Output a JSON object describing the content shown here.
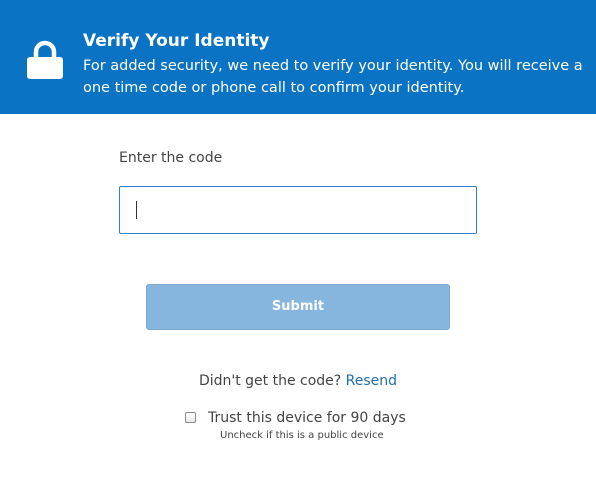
{
  "header": {
    "icon": "lock-icon",
    "title": "Verify Your Identity",
    "description": "For added security, we need to verify your identity. You will receive a one time code or phone call to confirm your identity.",
    "background_color": "#0a73c4"
  },
  "form": {
    "code_label": "Enter the code",
    "code_value": "",
    "submit_label": "Submit",
    "submit_color": "#86b5de"
  },
  "resend": {
    "prompt": "Didn't get the code?",
    "link_label": "Resend"
  },
  "trust": {
    "label": "Trust this device for 90 days",
    "hint": "Uncheck if this is a public device",
    "checked": false
  }
}
